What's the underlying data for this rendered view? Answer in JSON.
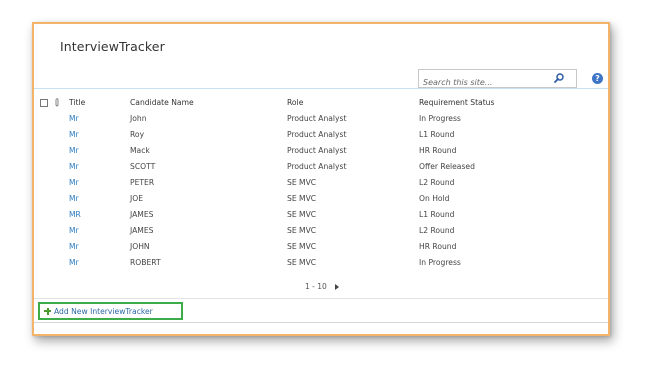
{
  "list": {
    "title": "InterviewTracker"
  },
  "search": {
    "placeholder": "Search this site..."
  },
  "table": {
    "headers": {
      "title": "Title",
      "candidate_name": "Candidate Name",
      "role": "Role",
      "requirement_status": "Requirement Status"
    },
    "rows": [
      {
        "title": "Mr",
        "candidate_name": "John",
        "role": "Product Analyst",
        "requirement_status": "In Progress"
      },
      {
        "title": "Mr",
        "candidate_name": "Roy",
        "role": "Product Analyst",
        "requirement_status": "L1 Round"
      },
      {
        "title": "Mr",
        "candidate_name": "Mack",
        "role": "Product Analyst",
        "requirement_status": "HR Round"
      },
      {
        "title": "Mr",
        "candidate_name": "SCOTT",
        "role": "Product Analyst",
        "requirement_status": "Offer Released"
      },
      {
        "title": "Mr",
        "candidate_name": "PETER",
        "role": "SE MVC",
        "requirement_status": "L2 Round"
      },
      {
        "title": "Mr",
        "candidate_name": "JOE",
        "role": "SE MVC",
        "requirement_status": "On Hold"
      },
      {
        "title": "MR",
        "candidate_name": "JAMES",
        "role": "SE MVC",
        "requirement_status": "L1 Round"
      },
      {
        "title": "Mr",
        "candidate_name": "JAMES",
        "role": "SE MVC",
        "requirement_status": "L2 Round"
      },
      {
        "title": "Mr",
        "candidate_name": "JOHN",
        "role": "SE MVC",
        "requirement_status": "HR Round"
      },
      {
        "title": "Mr",
        "candidate_name": "ROBERT",
        "role": "SE MVC",
        "requirement_status": "In Progress"
      }
    ]
  },
  "pager": {
    "range": "1 - 10"
  },
  "footer": {
    "add_new_label": "Add New InterviewTracker"
  },
  "icons": {
    "search": "search-icon",
    "help": "help-icon",
    "attachment": "attachment-icon",
    "add": "plus-icon",
    "next_page": "next-page-icon"
  },
  "colors": {
    "frame_border": "#f2b46a",
    "link": "#2a7bc0",
    "add_new_highlight": "#3cac49",
    "help_icon": "#3d74c6"
  }
}
